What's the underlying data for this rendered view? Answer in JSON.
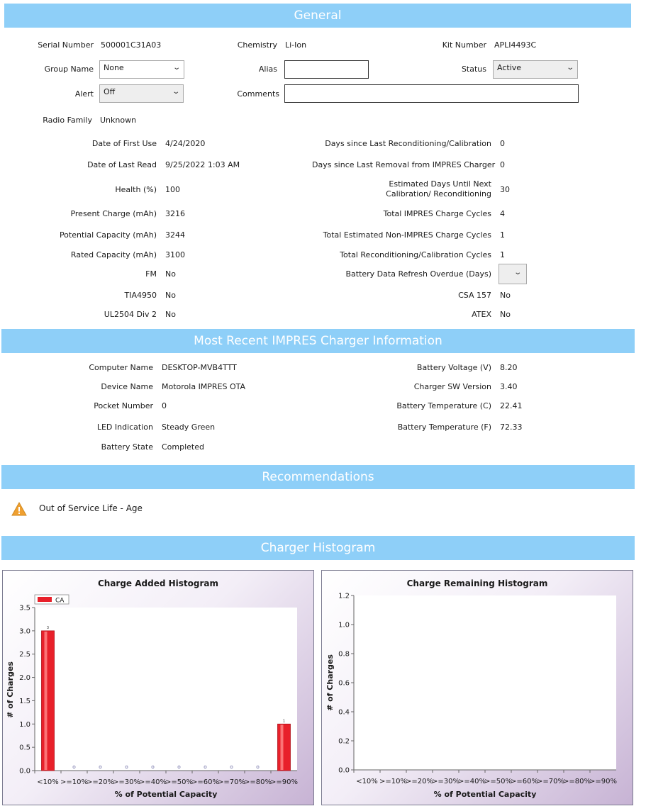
{
  "general": {
    "header": "General",
    "serial_number_label": "Serial Number",
    "serial_number": "500001C31A03",
    "chemistry_label": "Chemistry",
    "chemistry": "Li-Ion",
    "kit_number_label": "Kit Number",
    "kit_number": "APLI4493C",
    "group_name_label": "Group Name",
    "group_name": "None",
    "alias_label": "Alias",
    "alias": "",
    "status_label": "Status",
    "status": "Active",
    "alert_label": "Alert",
    "alert": "Off",
    "comments_label": "Comments",
    "comments": "",
    "radio_family_label": "Radio Family",
    "radio_family": "Unknown",
    "left_fields": [
      {
        "label": "Date of First Use",
        "value": "4/24/2020"
      },
      {
        "label": "Date of Last Read",
        "value": "9/25/2022 1:03 AM"
      },
      {
        "label": "Health (%)",
        "value": "100"
      },
      {
        "label": "Present Charge (mAh)",
        "value": "3216"
      },
      {
        "label": "Potential Capacity (mAh)",
        "value": "3244"
      },
      {
        "label": "Rated Capacity (mAh)",
        "value": "3100"
      },
      {
        "label": "FM",
        "value": "No"
      },
      {
        "label": "TIA4950",
        "value": "No"
      },
      {
        "label": "UL2504 Div 2",
        "value": "No"
      }
    ],
    "right_fields": [
      {
        "label": "Days since Last Reconditioning/Calibration",
        "value": "0"
      },
      {
        "label": "Days since Last Removal from IMPRES Charger",
        "value": "0"
      },
      {
        "label": "Estimated Days Until Next Calibration/ Reconditioning",
        "value": "30"
      },
      {
        "label": "Total IMPRES Charge Cycles",
        "value": "4"
      },
      {
        "label": "Total Estimated Non-IMPRES Charge Cycles",
        "value": "1"
      },
      {
        "label": "Total Reconditioning/Calibration Cycles",
        "value": "1"
      },
      {
        "label": "Battery Data Refresh Overdue (Days)",
        "value": ""
      },
      {
        "label": "CSA 157",
        "value": "No"
      },
      {
        "label": "ATEX",
        "value": "No"
      }
    ]
  },
  "charger_info": {
    "header": "Most Recent IMPRES Charger Information",
    "left_fields": [
      {
        "label": "Computer Name",
        "value": "DESKTOP-MVB4TTT"
      },
      {
        "label": "Device Name",
        "value": "Motorola IMPRES OTA"
      },
      {
        "label": "Pocket Number",
        "value": "0"
      },
      {
        "label": "LED Indication",
        "value": "Steady Green"
      },
      {
        "label": "Battery State",
        "value": "Completed"
      }
    ],
    "right_fields": [
      {
        "label": "Battery Voltage (V)",
        "value": "8.20"
      },
      {
        "label": "Charger SW Version",
        "value": "3.40"
      },
      {
        "label": "Battery Temperature (C)",
        "value": "22.41"
      },
      {
        "label": "Battery Temperature (F)",
        "value": "72.33"
      }
    ]
  },
  "recommendations": {
    "header": "Recommendations",
    "items": [
      {
        "icon": "warning-icon",
        "text": "Out of Service Life - Age"
      }
    ]
  },
  "histogram": {
    "header": "Charger Histogram"
  },
  "colors": {
    "header_band": "#8ecff8",
    "bar_fill": "#e8202a",
    "warning": "#f0a030"
  },
  "chart_data": [
    {
      "type": "bar",
      "title": "Charge Added Histogram",
      "xlabel": "% of Potential Capacity",
      "ylabel": "# of Charges",
      "categories": [
        "<10%",
        ">=10%",
        ">=20%",
        ">=30%",
        ">=40%",
        ">=50%",
        ">=60%",
        ">=70%",
        ">=80%",
        ">=90%"
      ],
      "series": [
        {
          "name": "CA",
          "values": [
            3,
            0,
            0,
            0,
            0,
            0,
            0,
            0,
            0,
            1
          ]
        }
      ],
      "ylim": [
        0,
        3.5
      ],
      "yticks": [
        "0.0",
        "0.5",
        "1.0",
        "1.5",
        "2.0",
        "2.5",
        "3.0",
        "3.5"
      ],
      "grid": false,
      "legend": "top-left"
    },
    {
      "type": "bar",
      "title": "Charge Remaining Histogram",
      "xlabel": "% of Potential Capacity",
      "ylabel": "# of Charges",
      "categories": [
        "<10%",
        ">=10%",
        ">=20%",
        ">=30%",
        ">=40%",
        ">=50%",
        ">=60%",
        ">=70%",
        ">=80%",
        ">=90%"
      ],
      "series": [],
      "ylim": [
        0,
        1.2
      ],
      "yticks": [
        "0.0",
        "0.2",
        "0.4",
        "0.6",
        "0.8",
        "1.0",
        "1.2"
      ],
      "grid": false
    }
  ]
}
